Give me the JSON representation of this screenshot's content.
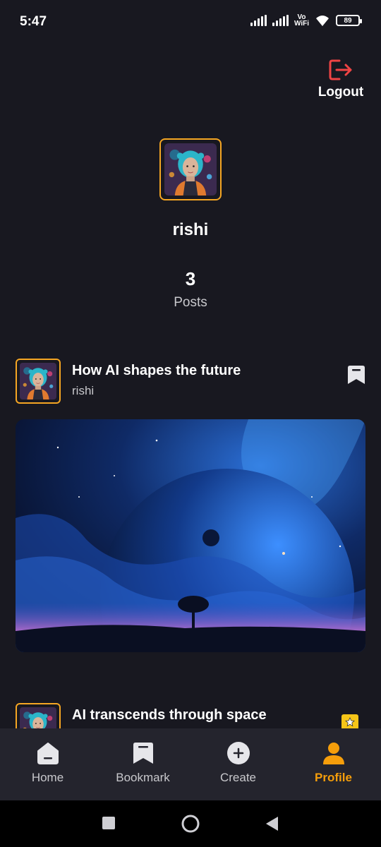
{
  "status_bar": {
    "time": "5:47",
    "network_label": "Vo\nWiFi",
    "battery": "89"
  },
  "header": {
    "logout_label": "Logout",
    "logout_color": "#ef4444"
  },
  "profile": {
    "name": "rishi",
    "post_count": "3",
    "post_count_label": "Posts",
    "avatar_icon": "ai-woman-avatar"
  },
  "posts": [
    {
      "title": "How AI shapes the future",
      "author": "rishi",
      "image": "space-planet-nebula-image",
      "bookmark_icon": "bookmark-icon"
    },
    {
      "title": "AI transcends through space",
      "author": "",
      "badge_icon": "star-badge-icon"
    }
  ],
  "bottom_nav": {
    "items": [
      {
        "label": "Home",
        "icon": "home-icon"
      },
      {
        "label": "Bookmark",
        "icon": "bookmark-icon"
      },
      {
        "label": "Create",
        "icon": "plus-circle-icon"
      },
      {
        "label": "Profile",
        "icon": "user-icon"
      }
    ],
    "active": "Profile",
    "accent_color": "#f59e0b"
  },
  "system_nav": {
    "buttons": [
      "recents",
      "home",
      "back"
    ]
  }
}
